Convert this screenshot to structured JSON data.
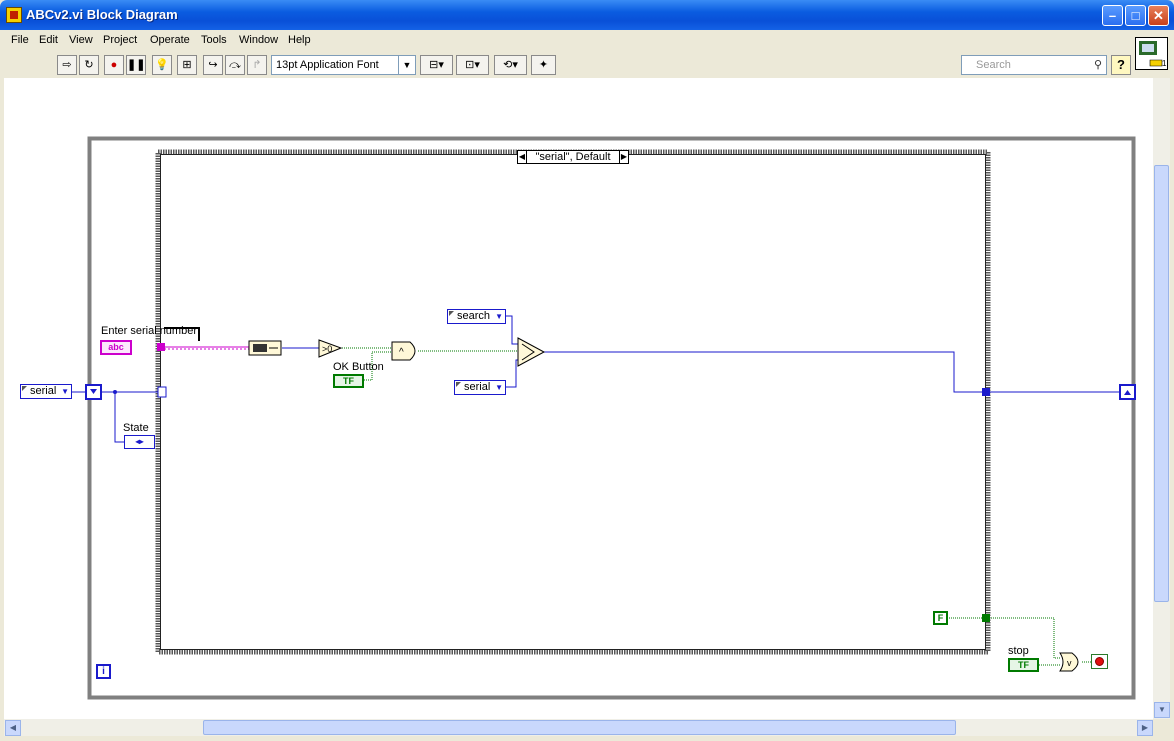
{
  "window": {
    "title": "ABCv2.vi Block Diagram"
  },
  "menu": [
    "File",
    "Edit",
    "View",
    "Project",
    "Operate",
    "Tools",
    "Window",
    "Help"
  ],
  "toolbar": {
    "font": "13pt Application Font",
    "search_placeholder": "Search",
    "help": "?"
  },
  "diagram": {
    "case_selector": "\"serial\", Default",
    "shift_register_enum": "serial",
    "controls": {
      "serial_input_label": "Enter serial number",
      "serial_input_type": "abc",
      "ok_button_label": "OK Button",
      "ok_button_type": "TF",
      "state_label": "State",
      "stop_label": "stop",
      "stop_type": "TF"
    },
    "constants": {
      "search": "search",
      "serial": "serial",
      "false_const": "F"
    },
    "case_terminal": "?",
    "iteration": "i"
  },
  "colors": {
    "string_wire": "#cc00cc",
    "enum_wire": "#1a1acc",
    "bool_wire": "#007a00"
  }
}
